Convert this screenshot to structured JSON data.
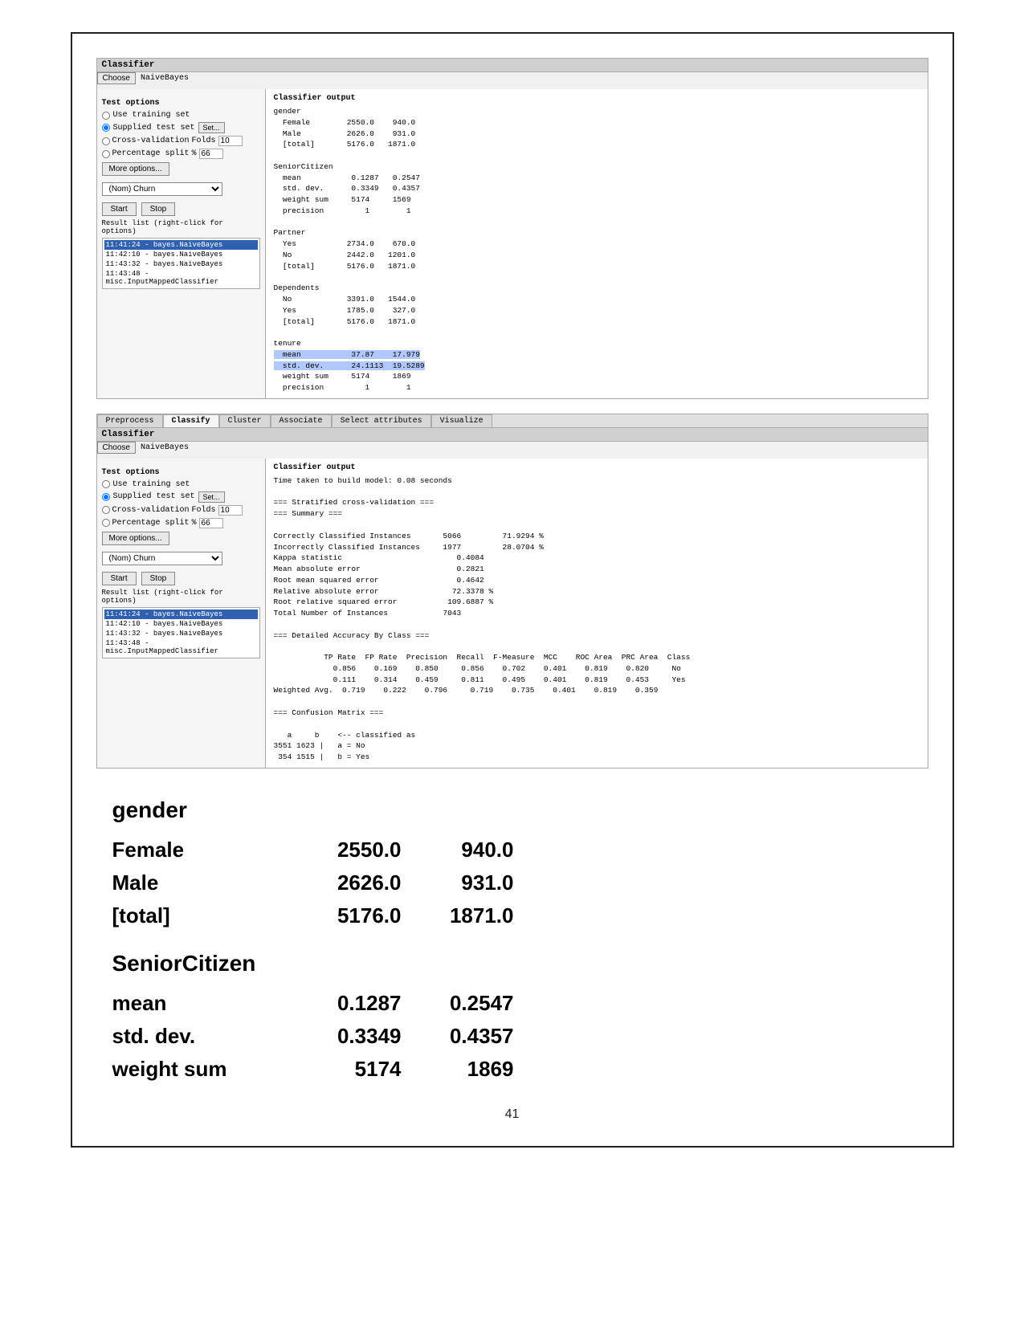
{
  "page": {
    "border": true,
    "page_number": "41"
  },
  "panel1": {
    "title": "Classifier",
    "choose_label": "NaiveBayes",
    "choose_btn": "Choose",
    "test_options_title": "Test options",
    "use_training_set": "Use training set",
    "supplied_test_set": "Supplied test set",
    "set_btn": "Set...",
    "cross_validation": "Cross-validation",
    "folds_label": "Folds",
    "folds_value": "10",
    "percentage_split": "Percentage split",
    "pct_value": "66",
    "more_options_btn": "More options...",
    "dropdown_value": "(Nom) Churn",
    "start_btn": "Start",
    "stop_btn": "Stop",
    "result_label": "Result list (right-click for options)",
    "results": [
      {
        "text": "11:41:24 - bayes.NaiveBayes",
        "selected": true
      },
      {
        "text": "11:42:10 - bayes.NaiveBayes",
        "selected": false
      },
      {
        "text": "11:43:32 - bayes.NaiveBayes",
        "selected": false
      },
      {
        "text": "11:43:48 - misc.InputMappedClassifier",
        "selected": false
      }
    ],
    "output_title": "Classifier output",
    "output_text": "gender\n  Female        2550.0    940.0\n  Male          2626.0    931.0\n  [total]       5176.0   1871.0\n\nSeniorCitizen\n  mean           0.1287   0.2547\n  std. dev.      0.3349   0.4357\n  weight sum     5174     1569\n  precision         1        1\n\nPartner\n  Yes           2734.0    670.0\n  No            2442.0   1201.0\n  [total]       5176.0   1871.0\n\nDependents\n  No            3391.0   1544.0\n  Yes           1785.0    327.0\n  [total]       5176.0   1871.0\n\ntenure\n  mean           37.87    17.979\n  std. dev.      24.1113  19.5289\n  weight sum     5174     1869\n  precision         1        1"
  },
  "panel2": {
    "tabs": [
      {
        "label": "Preprocess",
        "active": false
      },
      {
        "label": "Classify",
        "active": true
      },
      {
        "label": "Cluster",
        "active": false
      },
      {
        "label": "Associate",
        "active": false
      },
      {
        "label": "Select attributes",
        "active": false
      },
      {
        "label": "Visualize",
        "active": false
      }
    ],
    "title": "Classifier",
    "choose_label": "NaiveBayes",
    "choose_btn": "Choose",
    "test_options_title": "Test options",
    "use_training_set": "Use training set",
    "supplied_test_set": "Supplied test set",
    "set_btn": "Set...",
    "cross_validation": "Cross-validation",
    "folds_label": "Folds",
    "folds_value": "10",
    "percentage_split": "Percentage split",
    "pct_value": "66",
    "more_options_btn": "More options...",
    "dropdown_value": "(Nom) Churn",
    "start_btn": "Start",
    "stop_btn": "Stop",
    "result_label": "Result list (right-click for options)",
    "results": [
      {
        "text": "11:41:24 - bayes.NaiveBayes",
        "selected": true
      },
      {
        "text": "11:42:10 - bayes.NaiveBayes",
        "selected": false
      },
      {
        "text": "11:43:32 - bayes.NaiveBayes",
        "selected": false
      },
      {
        "text": "11:43:48 - misc.InputMappedClassifier",
        "selected": false
      }
    ],
    "output_title": "Classifier output",
    "output_text": "Time taken to build model: 0.08 seconds\n\n=== Stratified cross-validation ===\n=== Summary ===\n\nCorrectly Classified Instances       5066         71.9294 %\nIncorrectly Classified Instances     1977         28.0704 %\nKappa statistic                         0.4084\nMean absolute error                     0.2821\nRoot mean squared error                 0.4642\nRelative absolute error                72.3378 %\nRoot relative squared error           109.6887 %\nTotal Number of Instances            7043\n\n=== Detailed Accuracy By Class ===\n\n           TP Rate  FP Rate  Precision  Recall  F-Measure  MCC    ROC Area  PRC Area  Class\n             0.856    0.169    0.850     0.856    0.702    0.401    0.819    0.820     No\n             0.111    0.314    0.459     0.811    0.495    0.401    0.819    0.453     Yes\nWeighted Avg.  0.719    0.222    0.796     0.719    0.735    0.401    0.819    0.359\n\n=== Confusion Matrix ===\n\n   a     b    <-- classified as\n3551 1623 |   a = No\n 354 1515 |   b = Yes"
  },
  "large_section": {
    "category1": {
      "title": "gender",
      "rows": [
        {
          "label": "Female",
          "val1": "2550.0",
          "val2": "940.0"
        },
        {
          "label": "Male",
          "val1": "2626.0",
          "val2": "931.0"
        },
        {
          "label": "[total]",
          "val1": "5176.0",
          "val2": "1871.0"
        }
      ]
    },
    "category2": {
      "title": "SeniorCitizen",
      "rows": [
        {
          "label": "mean",
          "val1": "0.1287",
          "val2": "0.2547"
        },
        {
          "label": "std. dev.",
          "val1": "0.3349",
          "val2": "0.4357"
        },
        {
          "label": "weight sum",
          "val1": "5174",
          "val2": "1869"
        }
      ]
    }
  }
}
